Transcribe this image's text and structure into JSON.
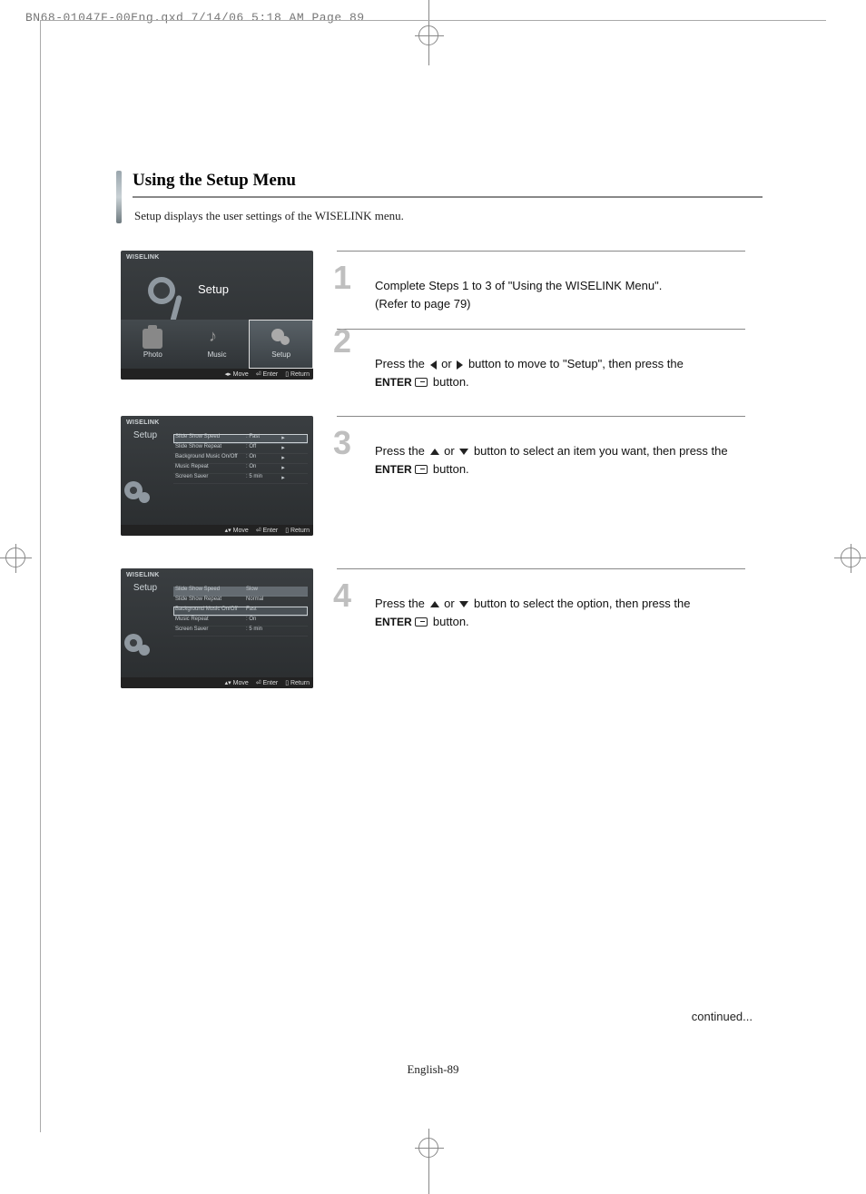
{
  "header_line": "BN68-01047F-00Eng.qxd  7/14/06  5:18 AM  Page 89",
  "title": "Using the Setup Menu",
  "subtitle": "Setup displays the user settings of the WISELINK menu.",
  "steps": {
    "s1": {
      "num": "1",
      "line1": "Complete Steps 1 to 3 of  \"Using the WISELINK Menu\".",
      "line2": "(Refer to page 79)"
    },
    "s2": {
      "num": "2",
      "pre": "Press the ",
      "mid": " or ",
      "post": " button to move to \"Setup\", then press the",
      "enter": "ENTER",
      "post2": " button."
    },
    "s3": {
      "num": "3",
      "pre": "Press the ",
      "mid": " or ",
      "post": " button to select an item you want, then press the",
      "enter": "ENTER",
      "post2": " button."
    },
    "s4": {
      "num": "4",
      "pre": "Press the ",
      "mid": " or ",
      "post": " button to select the option, then press the",
      "enter": "ENTER",
      "post2": " button."
    }
  },
  "shot": {
    "brand": "WISELINK",
    "setup_label": "Setup",
    "menu": {
      "photo": "Photo",
      "music": "Music",
      "setup": "Setup"
    },
    "footer": {
      "move_lr": "Move",
      "move_ud": "Move",
      "enter": "Enter",
      "return": "Return"
    },
    "list_rows": [
      {
        "k": "Slide Show Speed",
        "v": "Fast"
      },
      {
        "k": "Slide Show Repeat",
        "v": "Off"
      },
      {
        "k": "Background Music On/Off",
        "v": "On"
      },
      {
        "k": "Music Repeat",
        "v": "On"
      },
      {
        "k": "Screen Saver",
        "v": "5 min"
      }
    ],
    "list_rows_opt": [
      {
        "k": "Slide Show Speed",
        "v": "Slow"
      },
      {
        "k": "Slide Show Repeat",
        "v": "Normal"
      },
      {
        "k": "Background Music On/Off",
        "v": "Fast"
      },
      {
        "k": "Music Repeat",
        "v": "On"
      },
      {
        "k": "Screen Saver",
        "v": "5 min"
      }
    ]
  },
  "continued": "continued...",
  "footer": "English-89"
}
